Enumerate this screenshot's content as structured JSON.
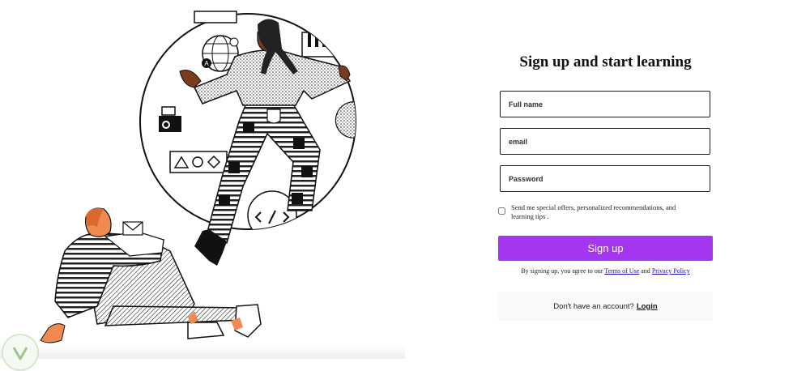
{
  "form": {
    "title": "Sign up and start learning",
    "fullname_placeholder": "Full name",
    "email_placeholder": "email",
    "password_placeholder": "Password",
    "offers_label": "Send me special offers, personalized recommendations, and learning tips .",
    "signup_label": "Sign up",
    "terms_prefix": "By signing up, you agree to our",
    "terms_link": "Terms of Use",
    "terms_and": "and",
    "privacy_link": "Privacy Policy",
    "login_prompt": "Don't have an account?",
    "login_link": "Login"
  },
  "colors": {
    "accent": "#a435f0",
    "text": "#1c1d1f",
    "login_box_bg": "#f7f9fa"
  },
  "illustration": {
    "icons": [
      "globe-icon",
      "piano-keys-icon",
      "camera-icon",
      "shapes-icon",
      "code-icon",
      "envelope-icon"
    ]
  }
}
